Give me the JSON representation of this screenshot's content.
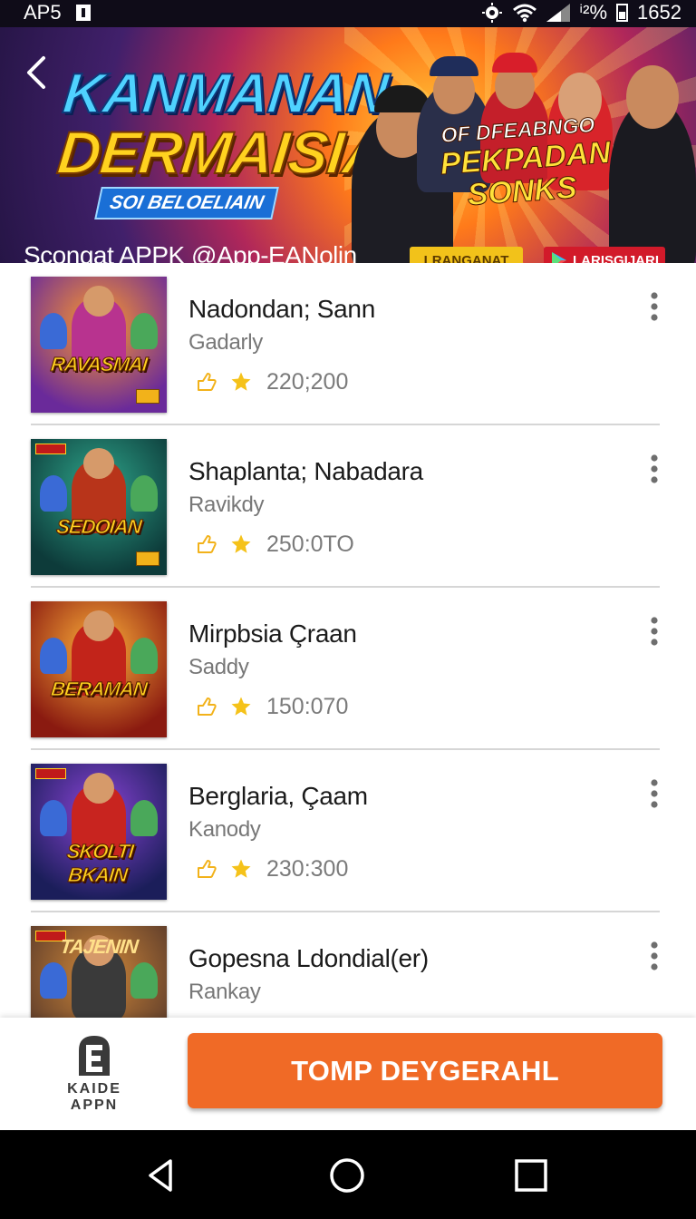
{
  "status_bar": {
    "carrier": "AP5",
    "battery_text": "ⁱ²%",
    "time": "1652"
  },
  "banner": {
    "title_line1": "KANMANAN",
    "title_line2": "DERMAISIAI",
    "ribbon": "SOI BELOELIAIN",
    "promo_line1": "OF DFEABNGO",
    "promo_line2": "PEKPADAN",
    "promo_line3": "SONKS",
    "subtitle": "Scongat APPK  @App-EANolin",
    "button_1": "LRANGANAT",
    "button_2": "LARISGIJARI"
  },
  "games": [
    {
      "title": "Nadondan; Sann",
      "subtitle": "Gadarly",
      "count": "220;200",
      "logo": "RAVASMAI",
      "accent": "#b8338f",
      "bg1": "#ff9a2a",
      "bg2": "#6a2a9a"
    },
    {
      "title": "Shaplanta; Nabadara",
      "subtitle": "Ravikdy",
      "count": "250:0TO",
      "logo": "SEDOIAN",
      "accent": "#b8341a",
      "bg1": "#2ea58a",
      "bg2": "#0d3b3a"
    },
    {
      "title": "Mirpbsia Çraan",
      "subtitle": "Saddy",
      "count": "150:070",
      "logo": "BERAMAN",
      "accent": "#c2241a",
      "bg1": "#ffb23a",
      "bg2": "#8a1a10"
    },
    {
      "title": "Berglaria, Çaam",
      "subtitle": "Kanody",
      "count": "230:300",
      "logo": "SKOLTI BKAIN",
      "accent": "#c8241f",
      "bg1": "#8a44d6",
      "bg2": "#1b1e5a"
    },
    {
      "title": "Gopesna Ldondial(er)",
      "subtitle": "Rankay",
      "count": "",
      "logo": "TAJENIN",
      "accent": "#3a3a3a",
      "bg1": "#d38a3a",
      "bg2": "#5a3a2a"
    }
  ],
  "footer": {
    "logo_line1": "KAIDE",
    "logo_line2": "APPN",
    "cta": "TOMP DEYGERAHL"
  },
  "colors": {
    "cta": "#f06a26",
    "star": "#f5c21a",
    "banner_yellow": "#ffd21f"
  },
  "icons": {
    "back": "back-arrow-icon",
    "more": "more-vert-icon",
    "like": "thumb-icon",
    "star": "star-icon",
    "nav_back": "nav-back-icon",
    "nav_home": "nav-home-icon",
    "nav_recent": "nav-recent-icon"
  }
}
